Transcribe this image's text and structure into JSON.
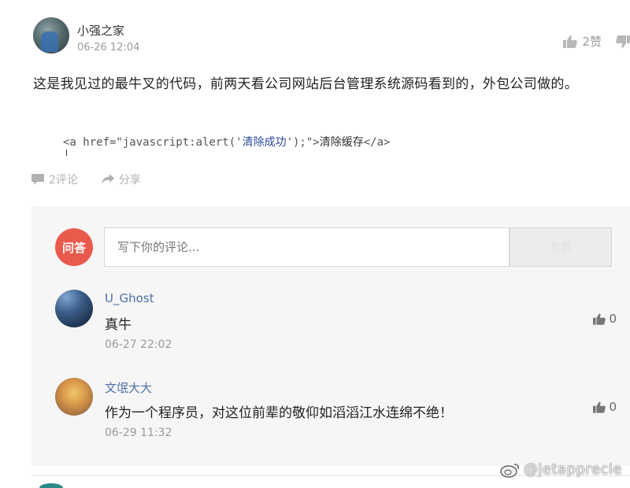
{
  "post": {
    "author": "小强之家",
    "date": "06-26 12:04",
    "likes_label": "2赞",
    "body": "这是我见过的最牛叉的代码，前两天看公司网站后台管理系统源码看到的，外包公司做的。",
    "code": {
      "open": "<a href=\"javascript:alert('",
      "msg": "清除成功",
      "mid": "');\">",
      "text": "清除缓存",
      "close": "</a>"
    },
    "comment_label": "2评论",
    "share_label": "分享"
  },
  "comment_box": {
    "logo_text": "问答",
    "placeholder": "写下你的评论...",
    "send_label": "发表"
  },
  "comments": [
    {
      "user": "U_Ghost",
      "text": "真牛",
      "time": "06-27 22:02",
      "likes": "0"
    },
    {
      "user": "文氓大大",
      "text": "作为一个程序员，对这位前辈的敬仰如滔滔江水连绵不绝！",
      "time": "06-29 11:32",
      "likes": "0"
    }
  ],
  "watermark": "@jetapprecie",
  "icons": {
    "like": "thumbs-up-icon",
    "dislike": "thumbs-down-icon",
    "comment": "comment-bubble-icon",
    "share": "share-arrow-icon",
    "weibo": "weibo-icon"
  },
  "colors": {
    "brand": "#ea5a4c",
    "username": "#4a6fa8",
    "muted": "#9a9a9a"
  }
}
